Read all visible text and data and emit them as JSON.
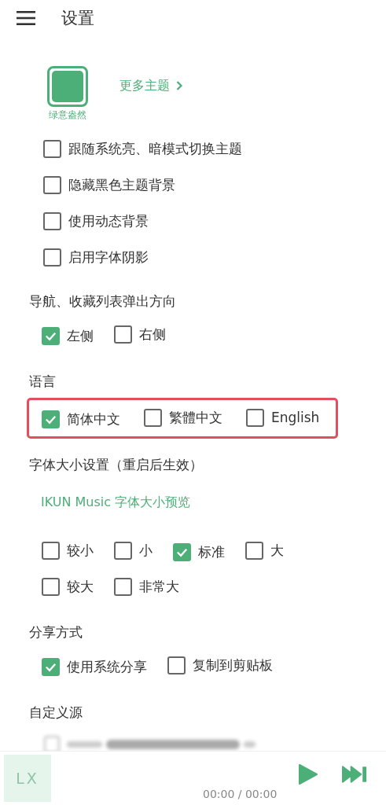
{
  "header": {
    "title": "设置"
  },
  "theme": {
    "swatches": [
      {
        "label": "绿意盎然",
        "color": "#4caf78",
        "selected": true
      }
    ],
    "more_link": "更多主题"
  },
  "theme_options": [
    {
      "label": "跟随系统亮、暗模式切换主题",
      "checked": false
    },
    {
      "label": "隐藏黑色主题背景",
      "checked": false
    },
    {
      "label": "使用动态背景",
      "checked": false
    },
    {
      "label": "启用字体阴影",
      "checked": false
    }
  ],
  "sections": [
    {
      "title": "导航、收藏列表弹出方向",
      "highlighted": false,
      "rows": [
        [
          {
            "label": "左侧",
            "checked": true
          },
          {
            "label": "右侧",
            "checked": false
          }
        ]
      ]
    },
    {
      "title": "语言",
      "highlighted": true,
      "rows": [
        [
          {
            "label": "简体中文",
            "checked": true
          },
          {
            "label": "繁體中文",
            "checked": false
          },
          {
            "label": "English",
            "checked": false
          }
        ]
      ]
    },
    {
      "title": "字体大小设置（重启后生效）",
      "highlighted": false,
      "preview": "IKUN Music 字体大小预览",
      "rows": [
        [
          {
            "label": "较小",
            "checked": false
          },
          {
            "label": "小",
            "checked": false
          },
          {
            "label": "标准",
            "checked": true
          },
          {
            "label": "大",
            "checked": false
          }
        ],
        [
          {
            "label": "较大",
            "checked": false
          },
          {
            "label": "非常大",
            "checked": false
          }
        ]
      ]
    },
    {
      "title": "分享方式",
      "highlighted": false,
      "rows": [
        [
          {
            "label": "使用系统分享",
            "checked": true
          },
          {
            "label": "复制到剪贴板",
            "checked": false
          }
        ]
      ]
    },
    {
      "title": "自定义源",
      "blurred": true
    }
  ],
  "player": {
    "logo": "LX",
    "time": "00:00 / 00:00"
  }
}
